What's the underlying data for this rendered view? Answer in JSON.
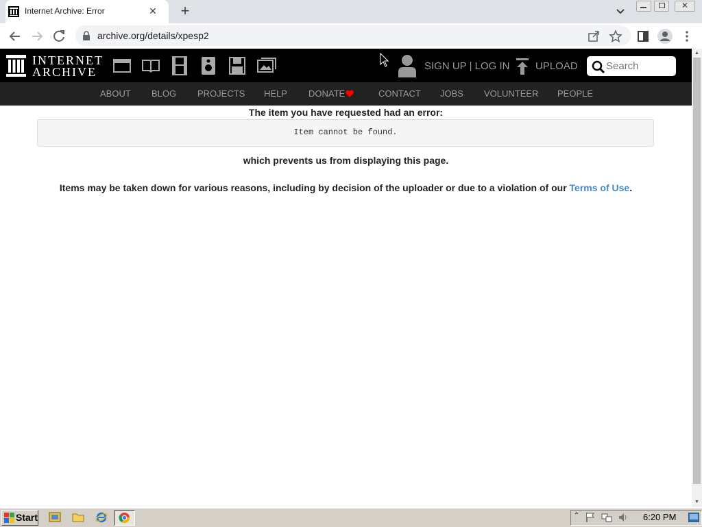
{
  "browser": {
    "tab_title": "Internet Archive: Error",
    "tab_close": "✕",
    "new_tab": "+",
    "url": "archive.org/details/xpesp2"
  },
  "header": {
    "logo_line1": "INTERNET",
    "logo_line2": "ARCHIVE",
    "media_icons": [
      "web-icon",
      "texts-icon",
      "video-icon",
      "audio-icon",
      "software-icon",
      "images-icon"
    ],
    "signup_login": "SIGN UP | LOG IN",
    "upload": "UPLOAD",
    "search_placeholder": "Search"
  },
  "nav": {
    "items": [
      "ABOUT",
      "BLOG",
      "PROJECTS",
      "HELP",
      "DONATE",
      "CONTACT",
      "JOBS",
      "VOLUNTEER",
      "PEOPLE"
    ]
  },
  "content": {
    "heading": "The item you have requested had an error:",
    "error_message": "Item cannot be found.",
    "prevents": "which prevents us from displaying this page.",
    "reason_text": "Items may be taken down for various reasons, including by decision of the uploader or due to a violation of our ",
    "terms_link": "Terms of Use",
    "reason_end": "."
  },
  "taskbar": {
    "start": "Start",
    "clock": "6:20 PM"
  },
  "colors": {
    "header_bg": "#000000",
    "nav_bg": "#222222",
    "link": "#428bca",
    "donate_heart": "#ff0000"
  }
}
